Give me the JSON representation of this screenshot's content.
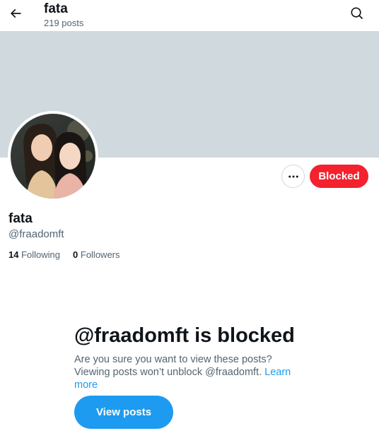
{
  "header": {
    "name": "fata",
    "post_count": "219 posts",
    "back_icon": "arrow-left-icon",
    "search_icon": "search-icon"
  },
  "profile": {
    "banner_color": "#cfd9de",
    "name": "fata",
    "handle": "@fraadomft",
    "following_count": "14",
    "following_label": "Following",
    "followers_count": "0",
    "followers_label": "Followers"
  },
  "actions": {
    "more_icon": "more-horizontal-icon",
    "blocked_label": "Blocked",
    "blocked_color": "#f4212e"
  },
  "blocked_notice": {
    "title": "@fraadomft is blocked",
    "description": "Are you sure you want to view these posts? Viewing posts won’t unblock @fraadomft.",
    "learn_more": "Learn more",
    "view_button": "View posts",
    "accent_color": "#1d9bf0"
  }
}
